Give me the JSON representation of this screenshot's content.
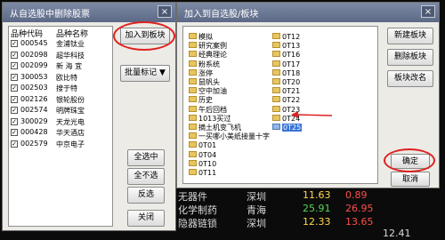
{
  "background_rows": [
    {
      "name": "无器件",
      "city": "深圳",
      "v1": "11.63",
      "v2": "0.89"
    },
    {
      "name": "化学制药",
      "city": "青海",
      "v1": "25.91",
      "v2": "26.95"
    },
    {
      "name": "隐器链锁",
      "city": "深圳",
      "v1": "12.33",
      "v2": "13.65"
    },
    {
      "name": "",
      "city": "",
      "v1": "",
      "v2": "12.41"
    }
  ],
  "stock_dialog": {
    "title": "从自选股中删除股票",
    "close": "×",
    "headers": {
      "code": "品种代码",
      "name": "品种名称"
    },
    "rows": [
      {
        "code": "000545",
        "name": "金浦钛业",
        "checked": "✓"
      },
      {
        "code": "002098",
        "name": "超华科技",
        "checked": "✓"
      },
      {
        "code": "002099",
        "name": "新 海 宜",
        "checked": "✓"
      },
      {
        "code": "300053",
        "name": "欧比特",
        "checked": "✓"
      },
      {
        "code": "002503",
        "name": "搜于特",
        "checked": "✓"
      },
      {
        "code": "002126",
        "name": "银轮股份",
        "checked": "✓"
      },
      {
        "code": "002574",
        "name": "明牌珠宝",
        "checked": "✓"
      },
      {
        "code": "300029",
        "name": "天龙光电",
        "checked": "✓"
      },
      {
        "code": "000428",
        "name": "华天酒店",
        "checked": "✓"
      },
      {
        "code": "002579",
        "name": "中京电子",
        "checked": "✓"
      }
    ],
    "buttons": {
      "add_to_block": "加入到板块",
      "batch_mark": "批量标记 ▼",
      "select_all": "全选中",
      "deselect_all": "全不选",
      "invert": "反选",
      "close": "关闭"
    }
  },
  "block_dialog": {
    "title": "加入到自选股/板块",
    "close": "×",
    "tree_col1": [
      "模拟",
      "研究案例",
      "经典理论",
      "粉系统",
      "涨停",
      "鼠帆头",
      "空中加油",
      "历史",
      "午后回档",
      "1013买过",
      "摘土机变飞机",
      "一买哪小美纸接量十字",
      "0T01",
      "0T04",
      "0T10",
      "0T11"
    ],
    "tree_col2": [
      "0T12",
      "0T13",
      "0T16",
      "0T17",
      "0T18",
      "0T20",
      "0T21",
      "0T22",
      "0T23",
      "0T24",
      "0T25"
    ],
    "selected": "0T25",
    "buttons": {
      "new_block": "新建板块",
      "delete_block": "删除板块",
      "rename_block": "板块改名",
      "ok": "确定",
      "cancel": "取消"
    }
  }
}
